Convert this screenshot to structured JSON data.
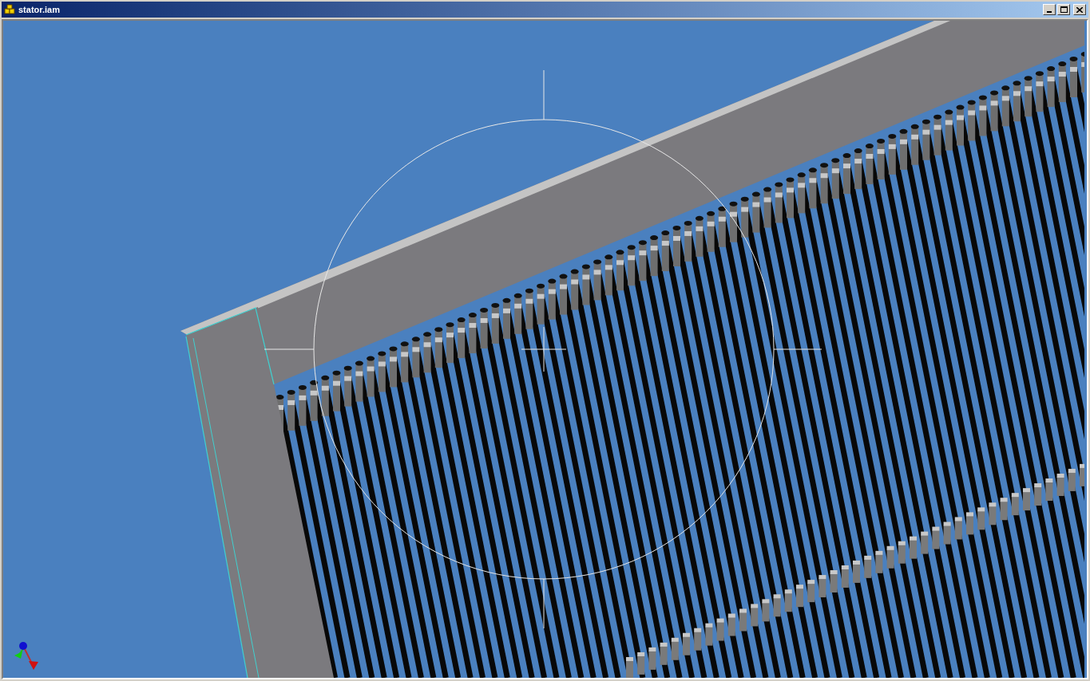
{
  "window": {
    "title": "stator.iam"
  }
}
